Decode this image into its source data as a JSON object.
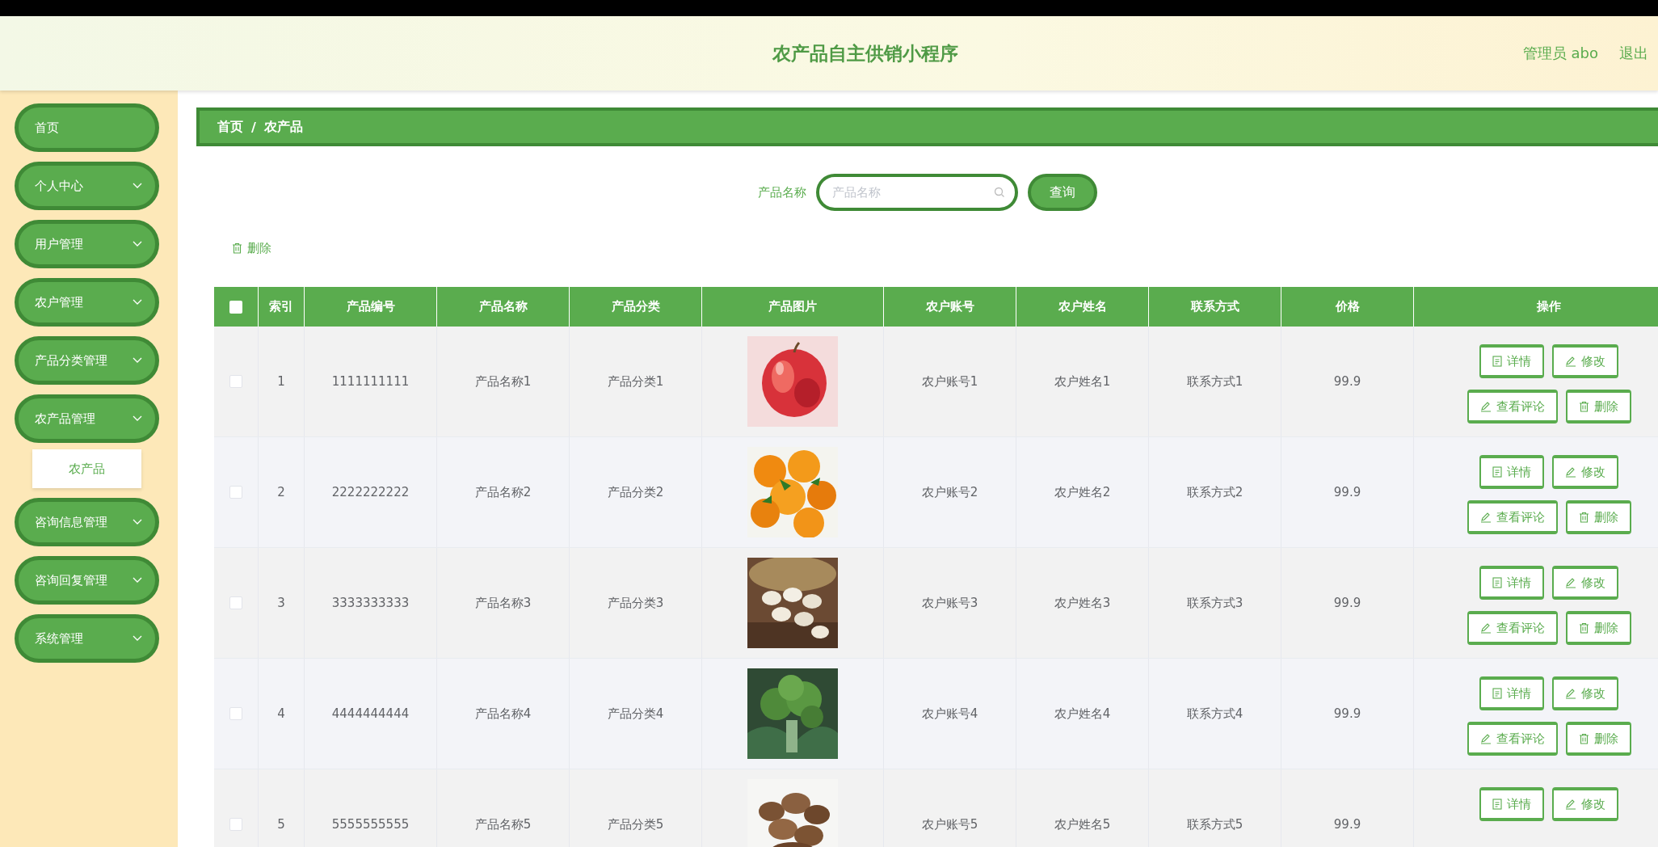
{
  "header": {
    "title": "农产品自主供销小程序",
    "user": "管理员 abo",
    "logout": "退出"
  },
  "sidebar": {
    "items": [
      {
        "label": "首页",
        "kind": "link"
      },
      {
        "label": "个人中心",
        "kind": "menu"
      },
      {
        "label": "用户管理",
        "kind": "menu"
      },
      {
        "label": "农户管理",
        "kind": "menu"
      },
      {
        "label": "产品分类管理",
        "kind": "menu"
      },
      {
        "label": "农产品管理",
        "kind": "menu",
        "children": [
          {
            "label": "农产品"
          }
        ]
      },
      {
        "label": "咨询信息管理",
        "kind": "menu"
      },
      {
        "label": "咨询回复管理",
        "kind": "menu"
      },
      {
        "label": "系统管理",
        "kind": "menu"
      }
    ]
  },
  "breadcrumb": {
    "items": [
      "首页",
      "农产品"
    ],
    "separator": "/"
  },
  "search": {
    "label": "产品名称",
    "placeholder": "产品名称",
    "button": "查询"
  },
  "delete_button": "删除",
  "table": {
    "select_all": {
      "checked": false
    },
    "columns": [
      "索引",
      "产品编号",
      "产品名称",
      "产品分类",
      "产品图片",
      "农户账号",
      "农户姓名",
      "联系方式",
      "价格",
      "操作"
    ],
    "rows": [
      {
        "checked": false,
        "index": "1",
        "code": "1111111111",
        "name": "产品名称1",
        "category": "产品分类1",
        "image": {
          "kind": "picture"
        },
        "account": "农户账号1",
        "farmer": "农户姓名1",
        "contact": "联系方式1",
        "price": "99.9",
        "actions": [
          {
            "kind": "detail",
            "label": "详情"
          },
          {
            "kind": "edit",
            "label": "修改"
          },
          {
            "kind": "comments",
            "label": "查看评论"
          },
          {
            "kind": "delete",
            "label": "删除"
          }
        ]
      },
      {
        "checked": false,
        "index": "2",
        "code": "2222222222",
        "name": "产品名称2",
        "category": "产品分类2",
        "image": {
          "kind": "picture"
        },
        "account": "农户账号2",
        "farmer": "农户姓名2",
        "contact": "联系方式2",
        "price": "99.9",
        "actions": [
          {
            "kind": "detail",
            "label": "详情"
          },
          {
            "kind": "edit",
            "label": "修改"
          },
          {
            "kind": "comments",
            "label": "查看评论"
          },
          {
            "kind": "delete",
            "label": "删除"
          }
        ]
      },
      {
        "checked": false,
        "index": "3",
        "code": "3333333333",
        "name": "产品名称3",
        "category": "产品分类3",
        "image": {
          "kind": "picture"
        },
        "account": "农户账号3",
        "farmer": "农户姓名3",
        "contact": "联系方式3",
        "price": "99.9",
        "actions": [
          {
            "kind": "detail",
            "label": "详情"
          },
          {
            "kind": "edit",
            "label": "修改"
          },
          {
            "kind": "comments",
            "label": "查看评论"
          },
          {
            "kind": "delete",
            "label": "删除"
          }
        ]
      },
      {
        "checked": false,
        "index": "4",
        "code": "4444444444",
        "name": "产品名称4",
        "category": "产品分类4",
        "image": {
          "kind": "picture"
        },
        "account": "农户账号4",
        "farmer": "农户姓名4",
        "contact": "联系方式4",
        "price": "99.9",
        "actions": [
          {
            "kind": "detail",
            "label": "详情"
          },
          {
            "kind": "edit",
            "label": "修改"
          },
          {
            "kind": "comments",
            "label": "查看评论"
          },
          {
            "kind": "delete",
            "label": "删除"
          }
        ]
      },
      {
        "checked": false,
        "index": "5",
        "code": "5555555555",
        "name": "产品名称5",
        "category": "产品分类5",
        "image": {
          "kind": "picture"
        },
        "account": "农户账号5",
        "farmer": "农户姓名5",
        "contact": "联系方式5",
        "price": "99.9",
        "actions": [
          {
            "kind": "detail",
            "label": "详情"
          },
          {
            "kind": "edit",
            "label": "修改"
          }
        ]
      }
    ]
  }
}
